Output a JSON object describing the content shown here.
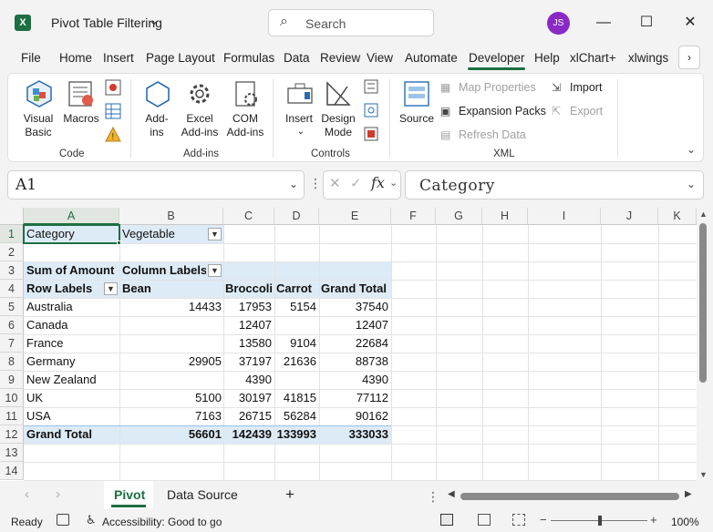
{
  "titlebar": {
    "app_icon": "excel-icon",
    "doc_title": "Pivot Table Filtering",
    "search_placeholder": "Search",
    "avatar_initials": "JS",
    "minimize": "—",
    "maximize": "☐",
    "close": "✕"
  },
  "menu": {
    "items": [
      "File",
      "Home",
      "Insert",
      "Page Layout",
      "Formulas",
      "Data",
      "Review",
      "View",
      "Automate",
      "Developer",
      "Help",
      "xlChart+",
      "xlwings"
    ],
    "active": "Developer",
    "accent": "#1d6f42"
  },
  "ribbon": {
    "code": {
      "group_label": "Code",
      "visual_basic": "Visual Basic",
      "macros": "Macros"
    },
    "addins": {
      "group_label": "Add-ins",
      "addins": "Add-ins",
      "excel_addins": "Excel Add-ins",
      "com_addins": "COM Add-ins"
    },
    "controls": {
      "group_label": "Controls",
      "insert": "Insert",
      "design_mode": "Design Mode"
    },
    "xml": {
      "group_label": "XML",
      "source": "Source",
      "map_properties": "Map Properties",
      "expansion_packs": "Expansion Packs",
      "refresh_data": "Refresh Data",
      "import": "Import",
      "export": "Export"
    }
  },
  "formula_bar": {
    "name_box": "A1",
    "formula": "Category"
  },
  "sheet": {
    "columns": [
      "A",
      "B",
      "C",
      "D",
      "E",
      "F",
      "G",
      "H",
      "I",
      "J",
      "K"
    ],
    "rows": [
      "1",
      "2",
      "3",
      "4",
      "5",
      "6",
      "7",
      "8",
      "9",
      "10",
      "11",
      "12",
      "13",
      "14"
    ],
    "filter_label": "Category",
    "filter_value": "Vegetable",
    "sum_label": "Sum of Amount",
    "column_labels": "Column Labels",
    "row_labels": "Row Labels",
    "headers": [
      "Bean",
      "Broccoli",
      "Carrot",
      "Grand Total"
    ],
    "data_rows": [
      {
        "label": "Australia",
        "values": [
          "14433",
          "17953",
          "5154",
          "37540"
        ]
      },
      {
        "label": "Canada",
        "values": [
          "",
          "12407",
          "",
          "12407"
        ]
      },
      {
        "label": "France",
        "values": [
          "",
          "13580",
          "9104",
          "22684"
        ]
      },
      {
        "label": "Germany",
        "values": [
          "29905",
          "37197",
          "21636",
          "88738"
        ]
      },
      {
        "label": "New Zealand",
        "values": [
          "",
          "4390",
          "",
          "4390"
        ]
      },
      {
        "label": "UK",
        "values": [
          "5100",
          "30197",
          "41815",
          "77112"
        ]
      },
      {
        "label": "USA",
        "values": [
          "7163",
          "26715",
          "56284",
          "90162"
        ]
      }
    ],
    "grand_total": {
      "label": "Grand Total",
      "values": [
        "56601",
        "142439",
        "133993",
        "333033"
      ]
    }
  },
  "tabs": {
    "sheets": [
      "Pivot",
      "Data Source"
    ],
    "active": "Pivot",
    "add": "+"
  },
  "status": {
    "ready": "Ready",
    "accessibility": "Accessibility: Good to go",
    "zoom": "100%"
  }
}
